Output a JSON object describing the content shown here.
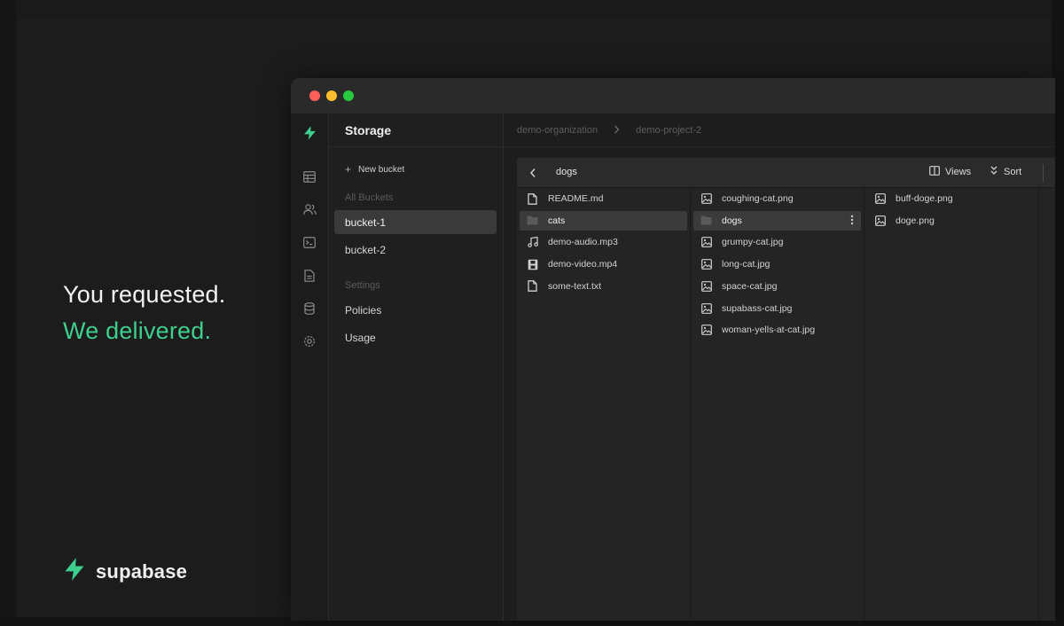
{
  "hero": {
    "line1": "You requested.",
    "line2": "We delivered.",
    "brand_name": "supabase"
  },
  "window": {
    "sidebar": {
      "title": "Storage",
      "new_bucket_label": "New bucket",
      "all_buckets_label": "All Buckets",
      "buckets": [
        {
          "label": "bucket-1",
          "active": true
        },
        {
          "label": "bucket-2",
          "active": false
        }
      ],
      "settings_label": "Settings",
      "settings_items": [
        {
          "label": "Policies"
        },
        {
          "label": "Usage"
        }
      ]
    },
    "breadcrumbs": [
      "demo-organization",
      "demo-project-2"
    ],
    "browser": {
      "path": "dogs",
      "views_label": "Views",
      "sort_label": "Sort",
      "columns": [
        [
          {
            "name": "README.md",
            "icon": "file-icon"
          },
          {
            "name": "cats",
            "icon": "folder-icon",
            "selected": true
          },
          {
            "name": "demo-audio.mp3",
            "icon": "music-icon"
          },
          {
            "name": "demo-video.mp4",
            "icon": "film-icon"
          },
          {
            "name": "some-text.txt",
            "icon": "file-icon"
          }
        ],
        [
          {
            "name": "coughing-cat.png",
            "icon": "image-icon"
          },
          {
            "name": "dogs",
            "icon": "folder-icon",
            "selected": true
          },
          {
            "name": "grumpy-cat.jpg",
            "icon": "image-icon"
          },
          {
            "name": "long-cat.jpg",
            "icon": "image-icon"
          },
          {
            "name": "space-cat.jpg",
            "icon": "image-icon"
          },
          {
            "name": "supabass-cat.jpg",
            "icon": "image-icon"
          },
          {
            "name": "woman-yells-at-cat.jpg",
            "icon": "image-icon"
          }
        ],
        [
          {
            "name": "buff-doge.png",
            "icon": "image-icon"
          },
          {
            "name": "doge.png",
            "icon": "image-icon"
          }
        ]
      ]
    }
  },
  "colors": {
    "brand_green": "#3ecf8e",
    "background": "#1c1c1c",
    "selected_row": "#3b3b3b"
  }
}
